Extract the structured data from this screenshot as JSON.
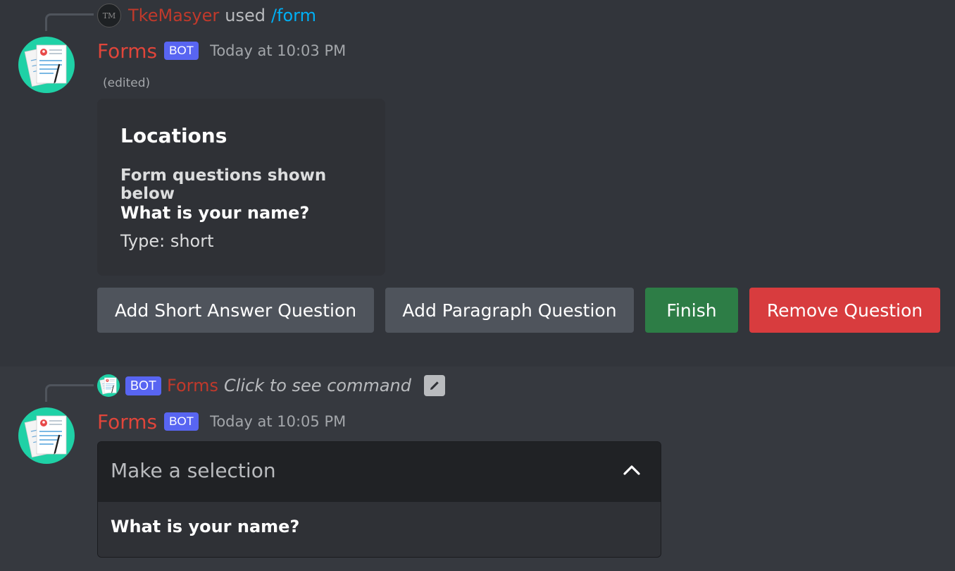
{
  "colors": {
    "author": "#e0453a",
    "command": "#00aff4",
    "bot_tag": "#5865f2",
    "button_grey": "#4f545c",
    "button_green": "#2d7d46",
    "button_red": "#d83c3e"
  },
  "message1": {
    "reply": {
      "user": "TkeMasyer",
      "used": "used",
      "command": "/form",
      "avatar_text": "TM"
    },
    "author": "Forms",
    "bot_tag": "BOT",
    "timestamp": "Today at 10:03 PM",
    "edited": "(edited)",
    "embed": {
      "title": "Locations",
      "subtitle": "Form questions shown below",
      "question": "What is your name?",
      "type_line": "Type: short"
    },
    "buttons": [
      {
        "label": "Add Short Answer Question",
        "style": "secondary"
      },
      {
        "label": "Add Paragraph Question",
        "style": "secondary"
      },
      {
        "label": "Finish",
        "style": "success"
      },
      {
        "label": "Remove Question",
        "style": "danger"
      }
    ]
  },
  "message2": {
    "reply": {
      "bot_tag": "BOT",
      "author": "Forms",
      "text": "Click to see command",
      "icon": "pencil-icon"
    },
    "author": "Forms",
    "bot_tag": "BOT",
    "timestamp": "Today at 10:05 PM",
    "select": {
      "placeholder": "Make a selection",
      "expanded": true,
      "options": [
        "What is your name?"
      ]
    }
  }
}
